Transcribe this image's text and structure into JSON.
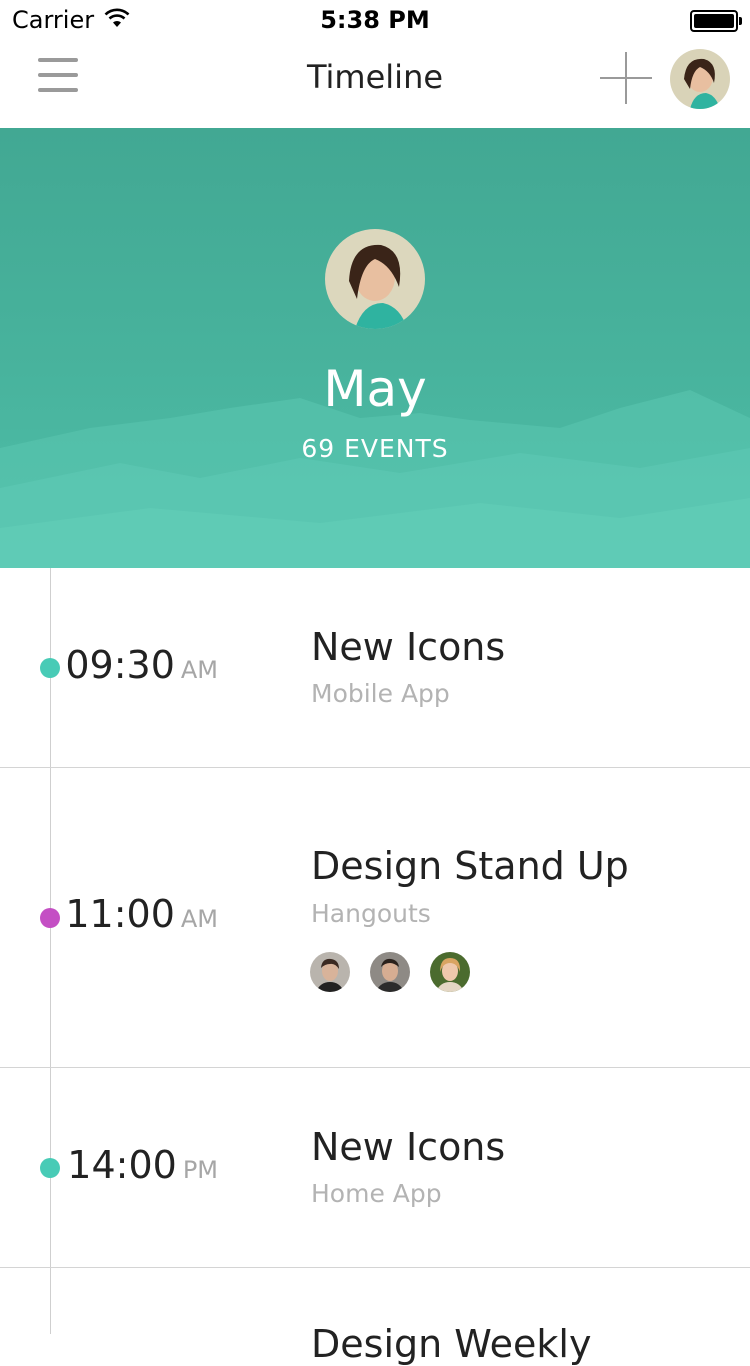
{
  "status_bar": {
    "carrier": "Carrier",
    "time": "5:38 PM"
  },
  "nav": {
    "title": "Timeline"
  },
  "hero": {
    "month": "May",
    "count": "69 EVENTS"
  },
  "events": [
    {
      "time": "09:30",
      "ampm": "AM",
      "title": "New Icons",
      "subtitle": "Mobile App",
      "dot_color": "#48cbb6"
    },
    {
      "time": "11:00",
      "ampm": "AM",
      "title": "Design Stand Up",
      "subtitle": "Hangouts",
      "dot_color": "#c44fc4"
    },
    {
      "time": "14:00",
      "ampm": "PM",
      "title": "New Icons",
      "subtitle": "Home App",
      "dot_color": "#48cbb6"
    }
  ],
  "partial_event": {
    "title": "Design Weekly"
  },
  "colors": {
    "accent": "#48cbb6",
    "hero_bg": "#45ae98",
    "purple": "#c44fc4"
  }
}
